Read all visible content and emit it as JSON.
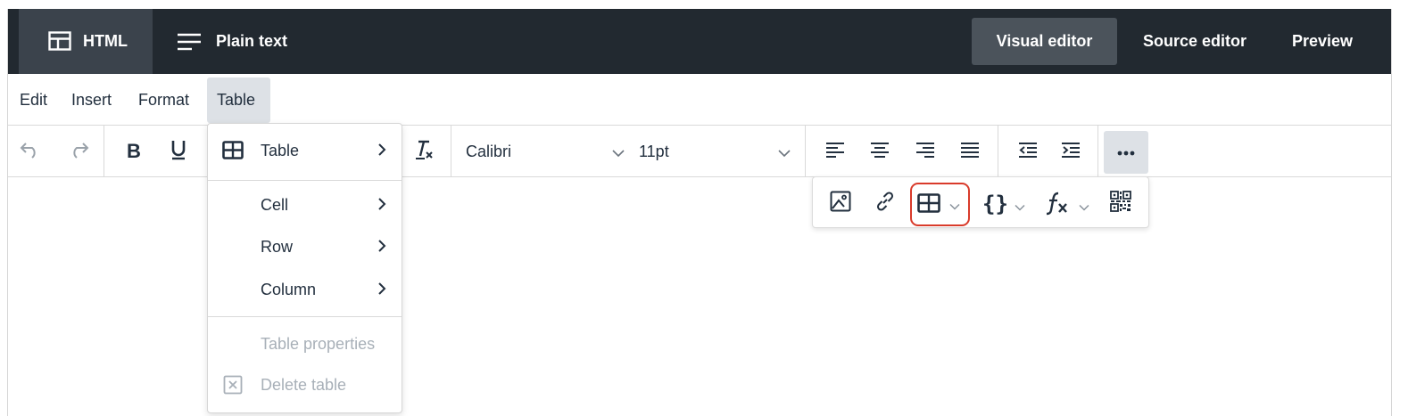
{
  "top_bar": {
    "mode_tabs": [
      {
        "label": "HTML",
        "icon": "layout-icon",
        "active": true
      },
      {
        "label": "Plain text",
        "icon": "lines-icon",
        "active": false
      }
    ],
    "editor_tabs": [
      {
        "label": "Visual editor",
        "active": true
      },
      {
        "label": "Source editor",
        "active": false
      },
      {
        "label": "Preview",
        "active": false
      }
    ]
  },
  "menubar": {
    "items": [
      "Edit",
      "Insert",
      "Format",
      "Table"
    ],
    "open_item": "Table"
  },
  "toolbar": {
    "font_family": "Calibri",
    "font_size": "11pt"
  },
  "table_menu": {
    "items": [
      {
        "label": "Table",
        "icon": "table-icon",
        "submenu": true,
        "enabled": true
      },
      {
        "label": "Cell",
        "submenu": true,
        "enabled": true
      },
      {
        "label": "Row",
        "submenu": true,
        "enabled": true
      },
      {
        "label": "Column",
        "submenu": true,
        "enabled": true
      },
      {
        "label": "Table properties",
        "submenu": false,
        "enabled": false
      },
      {
        "label": "Delete table",
        "icon": "delete-table-icon",
        "submenu": false,
        "enabled": false
      }
    ]
  },
  "overflow_toolbar": {
    "buttons": [
      "image-icon",
      "link-icon",
      "table-icon",
      "braces-icon",
      "formula-icon",
      "qr-code-icon"
    ],
    "highlighted": "table-icon"
  },
  "colors": {
    "topbar_bg": "#222930",
    "active_tab_bg": "#3b434c",
    "highlight_border": "#d93b2b",
    "menu_open_bg": "#dde1e6"
  }
}
